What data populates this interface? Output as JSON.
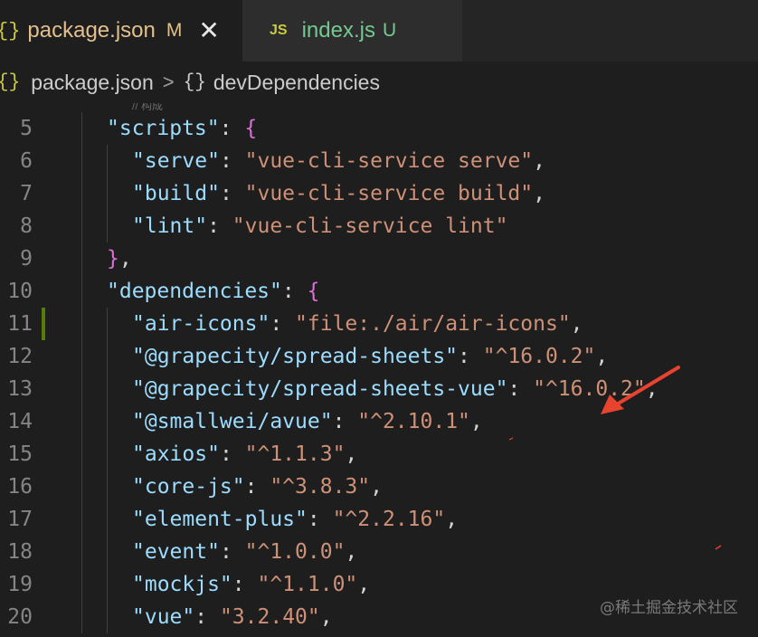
{
  "tabs": [
    {
      "icon": "json-braces-icon",
      "icon_text": "{}",
      "name": "package.json",
      "badge": "M",
      "close": "✕",
      "active": true
    },
    {
      "icon": "js-file-icon",
      "icon_text": "JS",
      "name": "index.js",
      "badge": "U",
      "active": false
    }
  ],
  "breadcrumb": {
    "items": [
      {
        "icon": "json-braces-icon",
        "icon_text": "{}",
        "label": "package.json"
      },
      {
        "icon": "object-braces-icon",
        "icon_text": "{}",
        "label": "devDependencies"
      }
    ],
    "separator": ">"
  },
  "editor": {
    "sticky_fragment": "// 构成",
    "lines": [
      {
        "no": "5",
        "key": "\"scripts\"",
        "colon": ": ",
        "open": "{"
      },
      {
        "no": "6",
        "key": "\"serve\"",
        "colon": ": ",
        "value": "\"vue-cli-service serve\"",
        "tail": ","
      },
      {
        "no": "7",
        "key": "\"build\"",
        "colon": ": ",
        "value": "\"vue-cli-service build\"",
        "tail": ","
      },
      {
        "no": "8",
        "key": "\"lint\"",
        "colon": ": ",
        "value": "\"vue-cli-service lint\"",
        "tail": ""
      },
      {
        "no": "9",
        "close": "}",
        "tail": ","
      },
      {
        "no": "10",
        "key": "\"dependencies\"",
        "colon": ": ",
        "open": "{"
      },
      {
        "no": "11",
        "key": "\"air-icons\"",
        "colon": ": ",
        "value": "\"file:./air/air-icons\"",
        "tail": ",",
        "modified": true
      },
      {
        "no": "12",
        "key": "\"@grapecity/spread-sheets\"",
        "colon": ": ",
        "value": "\"^16.0.2\"",
        "tail": ","
      },
      {
        "no": "13",
        "key": "\"@grapecity/spread-sheets-vue\"",
        "colon": ": ",
        "value": "\"^16.0.2\"",
        "tail": ","
      },
      {
        "no": "14",
        "key": "\"@smallwei/avue\"",
        "colon": ": ",
        "value": "\"^2.10.1\"",
        "tail": ","
      },
      {
        "no": "15",
        "key": "\"axios\"",
        "colon": ": ",
        "value": "\"^1.1.3\"",
        "tail": ","
      },
      {
        "no": "16",
        "key": "\"core-js\"",
        "colon": ": ",
        "value": "\"^3.8.3\"",
        "tail": ","
      },
      {
        "no": "17",
        "key": "\"element-plus\"",
        "colon": ": ",
        "value": "\"^2.2.16\"",
        "tail": ","
      },
      {
        "no": "18",
        "key": "\"event\"",
        "colon": ": ",
        "value": "\"^1.0.0\"",
        "tail": ","
      },
      {
        "no": "19",
        "key": "\"mockjs\"",
        "colon": ": ",
        "value": "\"^1.1.0\"",
        "tail": ","
      },
      {
        "no": "20",
        "key": "\"vue\"",
        "colon": ": ",
        "value": "\"3.2.40\"",
        "tail": ","
      }
    ]
  },
  "annotation": {
    "arrow_color": "#e8432e"
  },
  "watermark": "@稀土掘金技术社区",
  "colors": {
    "editor_bg": "#1e1e1e",
    "tabbar_bg": "#252526",
    "key": "#9cdcfe",
    "string": "#ce9178",
    "brace_level0": "#ffd700",
    "brace_level1": "#da70d6",
    "modified_gutter": "#587c0c",
    "git_modified": "#e2c08d",
    "git_untracked": "#73c991"
  }
}
